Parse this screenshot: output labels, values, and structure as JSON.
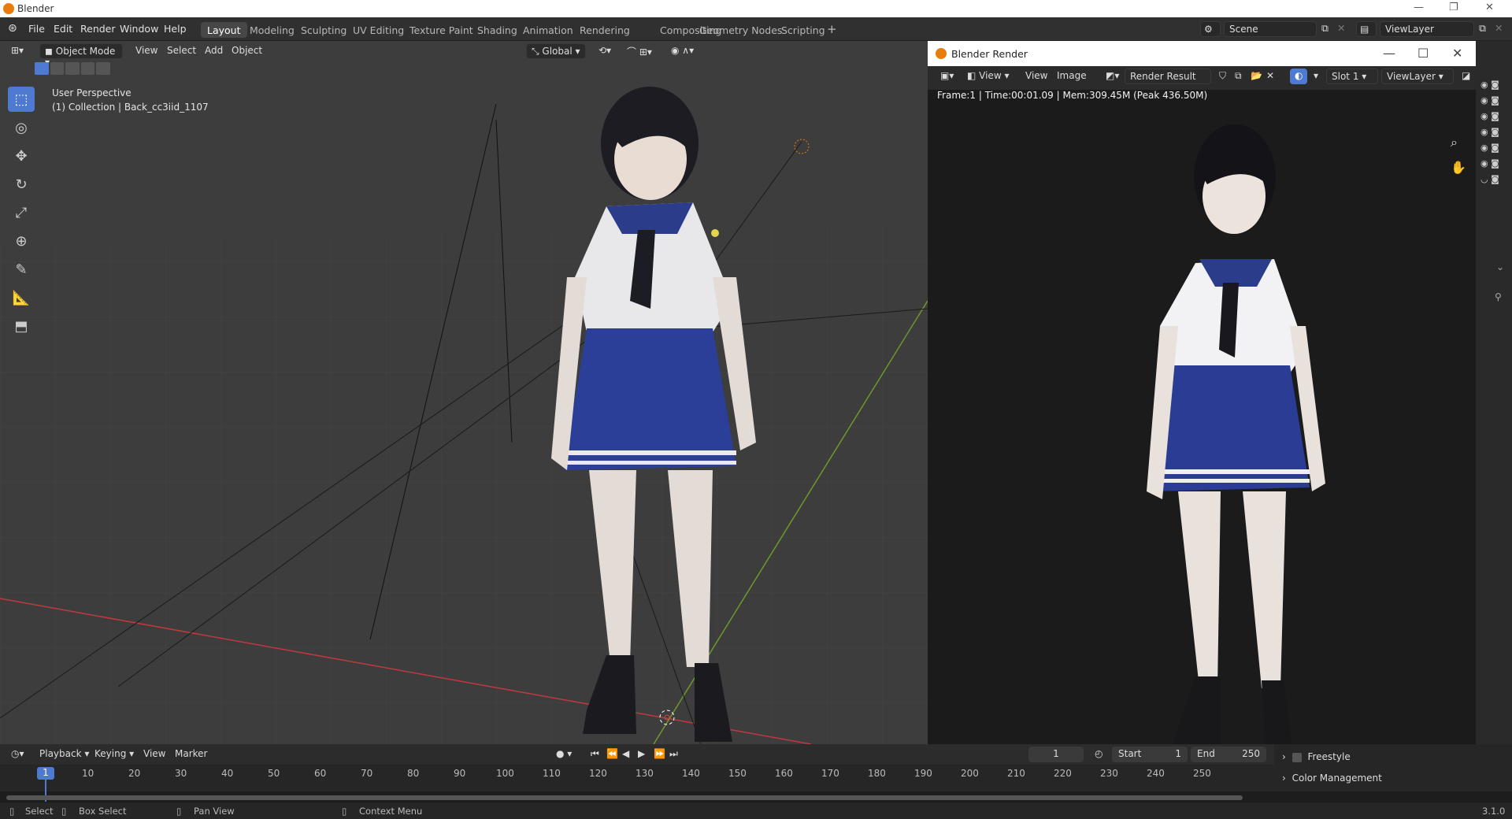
{
  "window": {
    "title": "Blender"
  },
  "menus": [
    "File",
    "Edit",
    "Render",
    "Window",
    "Help"
  ],
  "workspaces": [
    "Layout",
    "Modeling",
    "Sculpting",
    "UV Editing",
    "Texture Paint",
    "Shading",
    "Animation",
    "Rendering",
    "Compositing",
    "Geometry Nodes",
    "Scripting"
  ],
  "scene": {
    "name": "Scene",
    "view_layer": "ViewLayer"
  },
  "viewport": {
    "mode": "Object Mode",
    "menus": [
      "View",
      "Select",
      "Add",
      "Object"
    ],
    "orientation": "Global",
    "info_line1": "User Perspective",
    "info_line2": "(1) Collection | Back_cc3iid_1107"
  },
  "render_window": {
    "title": "Blender Render",
    "menu_view": "View",
    "menu_view2": "View",
    "menu_image": "Image",
    "image_name": "Render Result",
    "slot": "Slot 1",
    "view_layer": "ViewLayer",
    "info": "Frame:1 | Time:00:01.09 | Mem:309.45M (Peak 436.50M)"
  },
  "timeline": {
    "menus": [
      "Playback",
      "Keying",
      "View",
      "Marker"
    ],
    "current_frame": "1",
    "frame_field": "1",
    "start_label": "Start",
    "start": "1",
    "end_label": "End",
    "end": "250",
    "ticks": [
      "10",
      "20",
      "30",
      "40",
      "50",
      "60",
      "70",
      "80",
      "90",
      "100",
      "110",
      "120",
      "130",
      "140",
      "150",
      "160",
      "170",
      "180",
      "190",
      "200",
      "210",
      "220",
      "230",
      "240",
      "250"
    ]
  },
  "properties": {
    "panels": [
      "Freestyle",
      "Color Management"
    ]
  },
  "status": {
    "select": "Select",
    "box_select": "Box Select",
    "pan_view": "Pan View",
    "context_menu": "Context Menu",
    "version": "3.1.0"
  },
  "colors": {
    "accent": "#4f7ad1",
    "blender_orange": "#e87d0d",
    "x_axis": "#c0393f",
    "y_axis": "#6b9a2b"
  }
}
